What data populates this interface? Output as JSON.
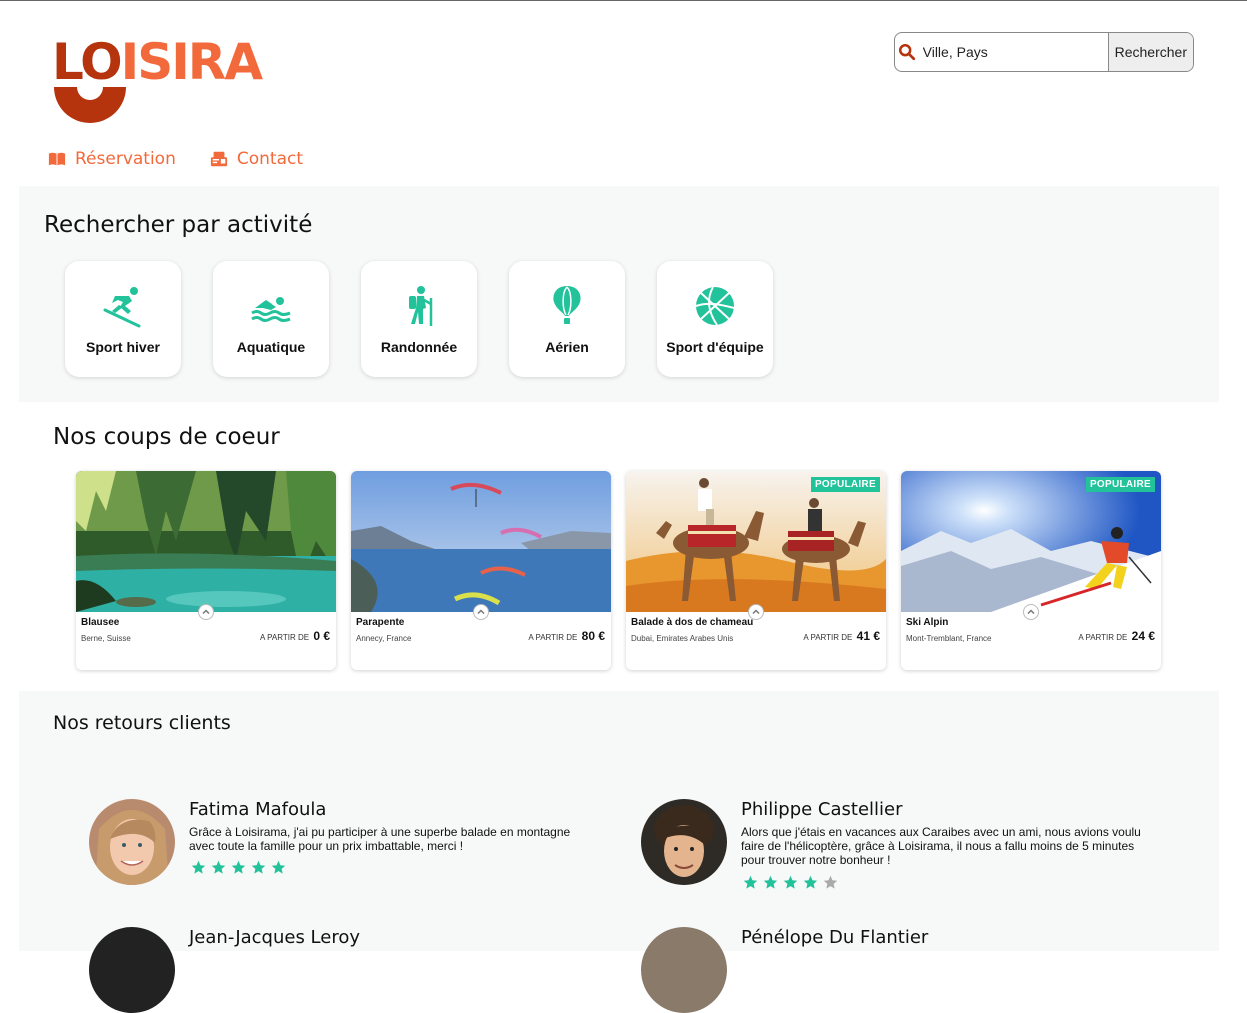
{
  "brand": {
    "logo_part1": "LO",
    "logo_part2": "ISIRA",
    "color_dark": "#b5330d",
    "color_light": "#f26a3c"
  },
  "search": {
    "placeholder": "Ville, Pays",
    "button_label": "Rechercher",
    "icon": "search-icon"
  },
  "nav": {
    "items": [
      {
        "label": "Réservation",
        "icon": "book-icon"
      },
      {
        "label": "Contact",
        "icon": "contact-icon"
      }
    ]
  },
  "activities": {
    "title": "Rechercher par activité",
    "items": [
      {
        "label": "Sport hiver",
        "icon": "skier-icon"
      },
      {
        "label": "Aquatique",
        "icon": "swimmer-icon"
      },
      {
        "label": "Randonnée",
        "icon": "hiker-icon"
      },
      {
        "label": "Aérien",
        "icon": "balloon-icon"
      },
      {
        "label": "Sport d'équipe",
        "icon": "basketball-icon"
      }
    ],
    "accent": "#22c29b"
  },
  "favorites": {
    "title": "Nos coups de coeur",
    "price_prefix": "A PARTIR DE",
    "cards": [
      {
        "name": "Blausee",
        "location": "Berne, Suisse",
        "price": "0 €",
        "badge": ""
      },
      {
        "name": "Parapente",
        "location": "Annecy, France",
        "price": "80 €",
        "badge": ""
      },
      {
        "name": "Balade à dos de chameau",
        "location": "Dubai, Emirates Arabes Unis",
        "price": "41 €",
        "badge": "POPULAIRE"
      },
      {
        "name": "Ski Alpin",
        "location": "Mont-Tremblant, France",
        "price": "24 €",
        "badge": "POPULAIRE"
      }
    ]
  },
  "reviews": {
    "title": "Nos retours clients",
    "items": [
      {
        "name": "Fatima Mafoula",
        "text": "Grâce à Loisirama, j'ai pu participer à une superbe balade en montagne avec toute la famille pour un prix imbattable, merci !",
        "rating": 5
      },
      {
        "name": "Philippe Castellier",
        "text": "Alors que j'étais en vacances aux Caraibes avec un ami, nous avions voulu faire de l'hélicoptère, grâce à Loisirama, il nous a fallu moins de 5 minutes pour trouver notre bonheur !",
        "rating": 4
      },
      {
        "name": "Jean-Jacques Leroy",
        "text": "",
        "rating": 0
      },
      {
        "name": "Pénélope Du Flantier",
        "text": "",
        "rating": 0
      }
    ],
    "star_color": "#22c29b",
    "star_empty_color": "#aaaaaa"
  }
}
